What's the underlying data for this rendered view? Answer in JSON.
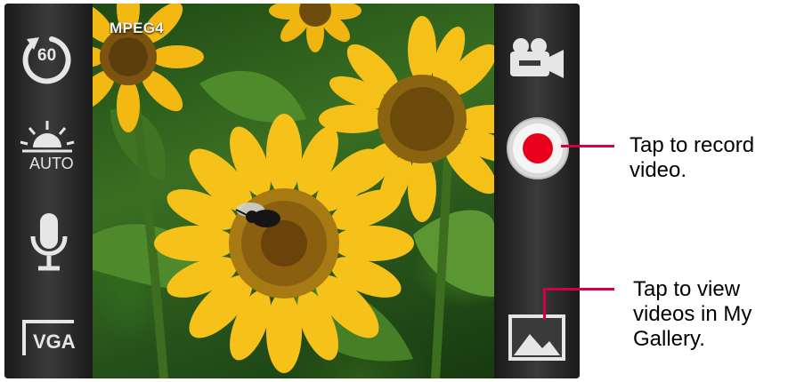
{
  "viewfinder": {
    "format_label": "MPEG4"
  },
  "left_controls": {
    "timer_label": "60",
    "brightness_label": "AUTO",
    "resolution_label": "VGA"
  },
  "right_controls": {
    "mode": "video-camera-icon",
    "record": "record-button",
    "gallery": "gallery-icon"
  },
  "callouts": {
    "record": [
      "Tap to record",
      "video."
    ],
    "gallery": [
      "Tap to view",
      "videos in My",
      "Gallery."
    ]
  },
  "colors": {
    "record_red": "#e8001c",
    "callout_line": "#d40046"
  }
}
